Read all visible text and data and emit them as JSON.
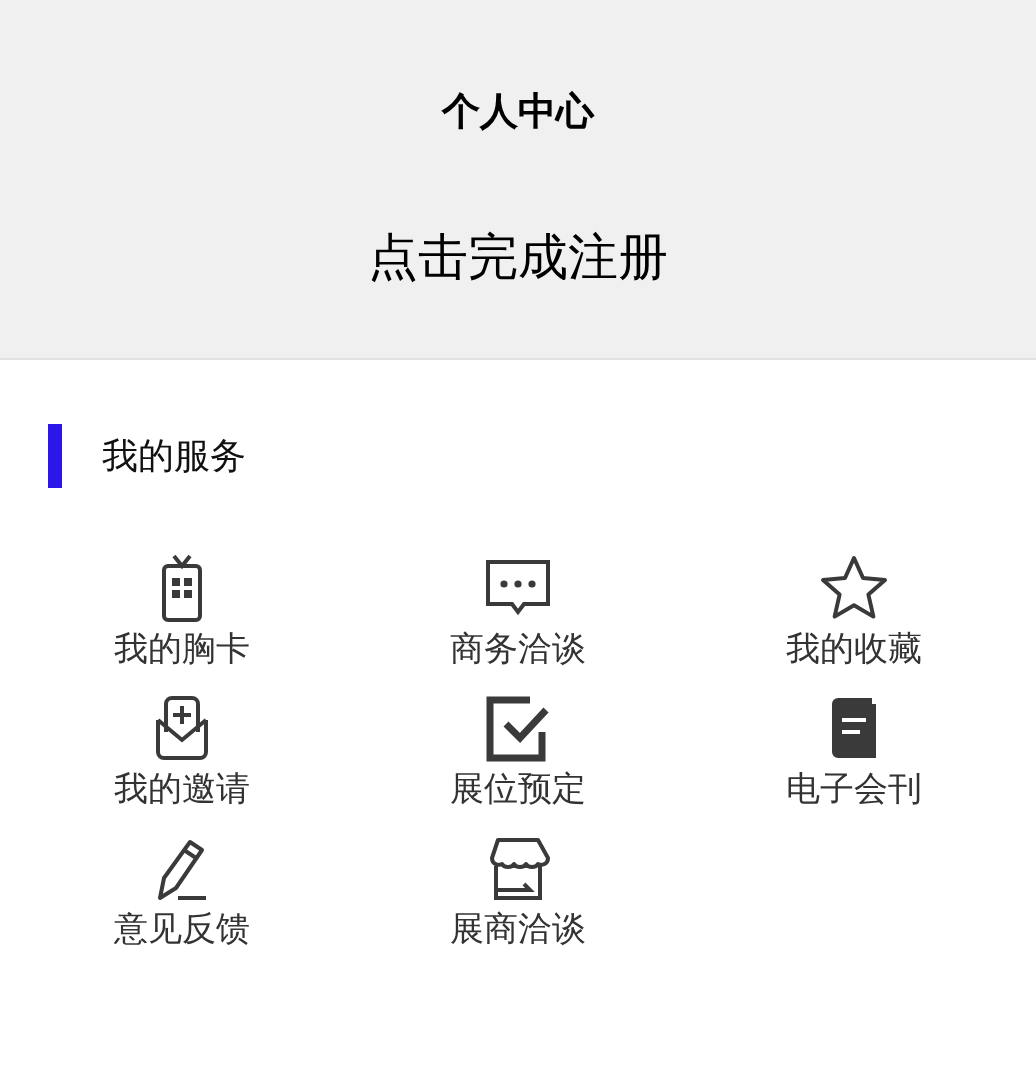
{
  "header": {
    "title": "个人中心",
    "register_link": "点击完成注册"
  },
  "services": {
    "title": "我的服务",
    "items": [
      {
        "label": "我的胸卡"
      },
      {
        "label": "商务洽谈"
      },
      {
        "label": "我的收藏"
      },
      {
        "label": "我的邀请"
      },
      {
        "label": "展位预定"
      },
      {
        "label": "电子会刊"
      },
      {
        "label": "意见反馈"
      },
      {
        "label": "展商洽谈"
      }
    ]
  }
}
